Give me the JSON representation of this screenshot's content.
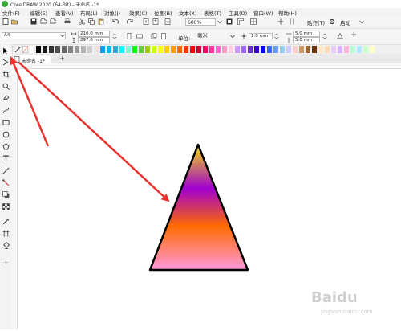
{
  "window": {
    "title": "CorelDRAW 2020 (64-Bit) - 未命名 -1*"
  },
  "menu": [
    "文件(F)",
    "编辑(E)",
    "查看(V)",
    "布局(L)",
    "对象(J)",
    "效果(C)",
    "位图(B)",
    "文本(X)",
    "表格(T)",
    "工具(O)",
    "窗口(W)",
    "帮助(H)"
  ],
  "toolbar": {
    "zoom": "600%",
    "snap_label": "贴齐(T)",
    "launch_label": "启动"
  },
  "property_bar": {
    "page_size": "A4",
    "width": "210.0 mm",
    "height": "297.0 mm",
    "units_label": "单位:",
    "units_value": "毫米",
    "nudge": "1.0 mm",
    "dup_x": "5.0 mm",
    "dup_y": "5.0 mm"
  },
  "tabs": {
    "doc_tab": "未命名 -1*",
    "add_tab": "+"
  },
  "watermark": {
    "text": "Baidu",
    "sub": "jingyan.baidu.com"
  },
  "palette_colors": [
    "#ffffff",
    "#000000",
    "#1a1a1a",
    "#333333",
    "#4d4d4d",
    "#666666",
    "#808080",
    "#999999",
    "#b3b3b3",
    "#cccccc",
    "#e6e6e6",
    "#00a0e9",
    "#00b7ee",
    "#2ea7e0",
    "#00ffff",
    "#7fffd4",
    "#00ff00",
    "#66cc33",
    "#99cc00",
    "#ccff00",
    "#ffff00",
    "#ffcc00",
    "#ff9900",
    "#ff6600",
    "#ff3300",
    "#ff0000",
    "#cc0033",
    "#ff0066",
    "#ff3399",
    "#ff66cc",
    "#ff99cc",
    "#ffccdd",
    "#cc99ff",
    "#9966ff",
    "#6633cc",
    "#3300cc",
    "#0000ff",
    "#3366ff",
    "#6699ff",
    "#99ccff",
    "#ccccff",
    "#ffcccc",
    "#cc9966",
    "#996633",
    "#663300",
    "#ffe6cc",
    "#ffd9b3",
    "#e6ccff",
    "#d9b3ff",
    "#ffb3d9",
    "#b3ffd9",
    "#b3e6ff",
    "#ccffcc",
    "#ffffcc"
  ],
  "gradient_colors": [
    "#f2e20a",
    "#a000d0",
    "#ff6a00",
    "#ff99dd"
  ],
  "arrow_color": "#e8322f"
}
